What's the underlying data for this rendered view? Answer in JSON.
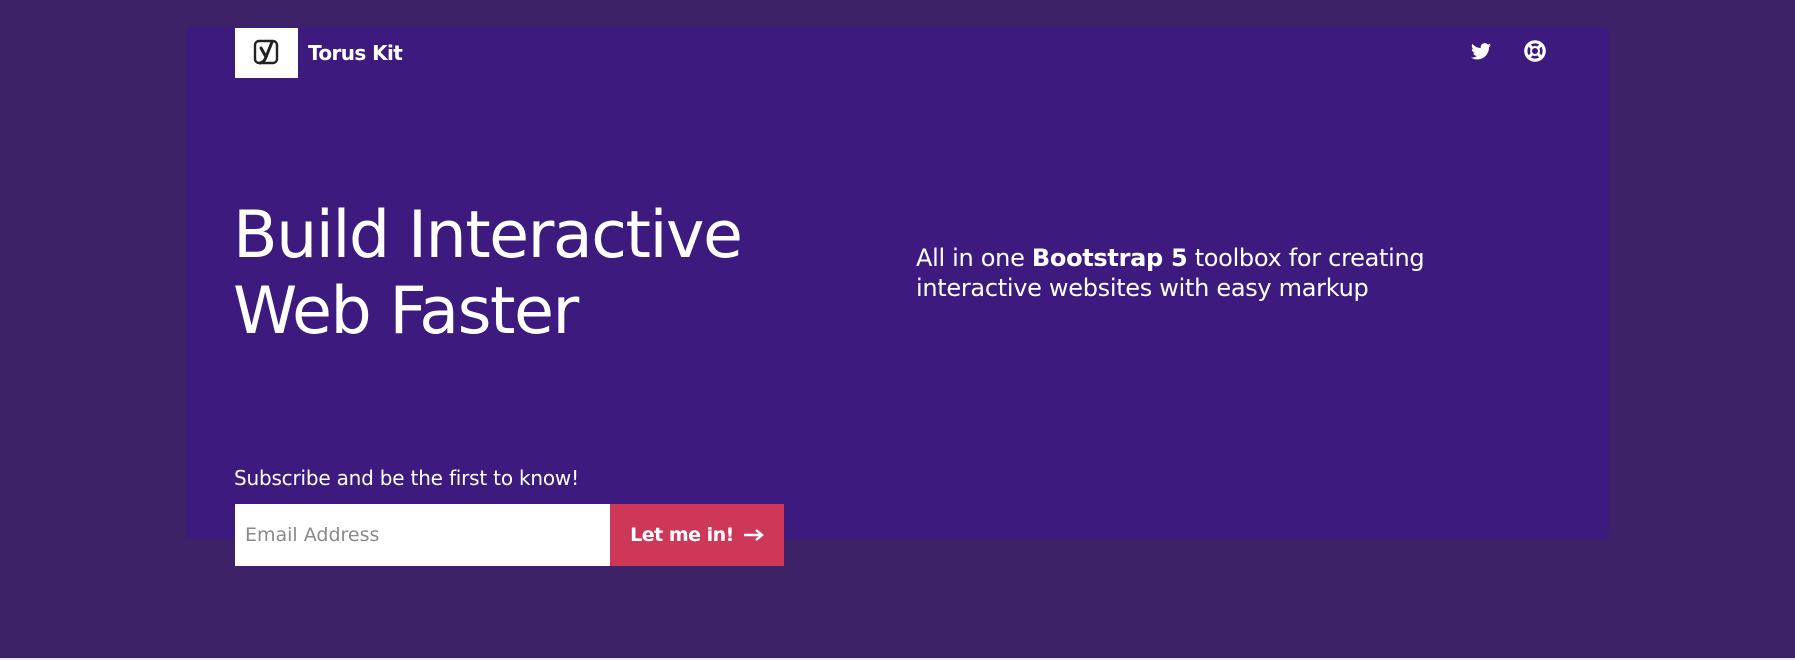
{
  "brand": {
    "name": "Torus Kit",
    "logo_icon": "yoast-y-logo-icon"
  },
  "nav": {
    "icons": [
      "twitter-icon",
      "life-ring-icon"
    ]
  },
  "hero": {
    "headline_line1": "Build Interactive",
    "headline_line2": "Web Faster",
    "tagline_before": "All in one ",
    "tagline_bold": "Bootstrap 5",
    "tagline_after": " toolbox for creating interactive websites with easy markup"
  },
  "subscribe": {
    "label": "Subscribe and be the first to know!",
    "email_placeholder": "Email Address",
    "email_value": "",
    "button_label": "Let me in!",
    "button_icon": "arrow-right-icon"
  },
  "colors": {
    "page_bg": "#3e2268",
    "hero_bg": "#3d1b7e",
    "button_bg": "#cd3858",
    "text": "#ffffff"
  }
}
